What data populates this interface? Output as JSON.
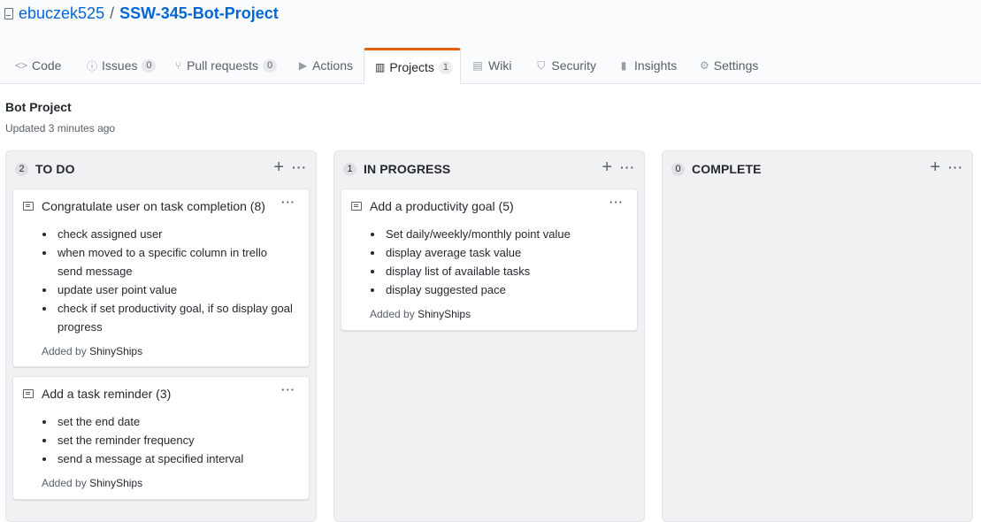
{
  "repo": {
    "owner": "ebuczek525",
    "separator": "/",
    "name": "SSW-345-Bot-Project"
  },
  "tabs": [
    {
      "icon": "code-icon",
      "glyph": "<>",
      "label": "Code"
    },
    {
      "icon": "issue-icon",
      "glyph": "ⓘ",
      "label": "Issues",
      "count": "0"
    },
    {
      "icon": "pull-request-icon",
      "glyph": "⑂",
      "label": "Pull requests",
      "count": "0"
    },
    {
      "icon": "play-icon",
      "glyph": "▶",
      "label": "Actions"
    },
    {
      "icon": "project-icon",
      "glyph": "▥",
      "label": "Projects",
      "count": "1",
      "selected": true
    },
    {
      "icon": "book-icon",
      "glyph": "▤",
      "label": "Wiki"
    },
    {
      "icon": "shield-icon",
      "glyph": "⛉",
      "label": "Security"
    },
    {
      "icon": "graph-icon",
      "glyph": "▮",
      "label": "Insights"
    },
    {
      "icon": "gear-icon",
      "glyph": "⚙",
      "label": "Settings"
    }
  ],
  "project": {
    "title": "Bot Project",
    "updated": "Updated 3 minutes ago"
  },
  "columns": [
    {
      "count": "2",
      "name": "TO DO",
      "cards": [
        {
          "title": "Congratulate user on task completion (8)",
          "items": [
            "check assigned user",
            "when moved to a specific column in trello send message",
            "update user point value",
            "check if set productivity goal, if so display goal progress"
          ],
          "added_by_label": "Added by",
          "added_by": "ShinyShips"
        },
        {
          "title": "Add a task reminder (3)",
          "items": [
            "set the end date",
            "set the reminder frequency",
            "send a message at specified interval"
          ],
          "added_by_label": "Added by",
          "added_by": "ShinyShips"
        }
      ]
    },
    {
      "count": "1",
      "name": "IN PROGRESS",
      "cards": [
        {
          "title": "Add a productivity goal (5)",
          "items": [
            "Set daily/weekly/monthly point value",
            "display average task value",
            "display list of available tasks",
            "display suggested pace"
          ],
          "added_by_label": "Added by",
          "added_by": "ShinyShips"
        }
      ]
    },
    {
      "count": "0",
      "name": "COMPLETE",
      "cards": []
    }
  ],
  "colors": {
    "accent": "#e36209",
    "link": "#0366d6",
    "column_bg": "#eff1f3"
  }
}
